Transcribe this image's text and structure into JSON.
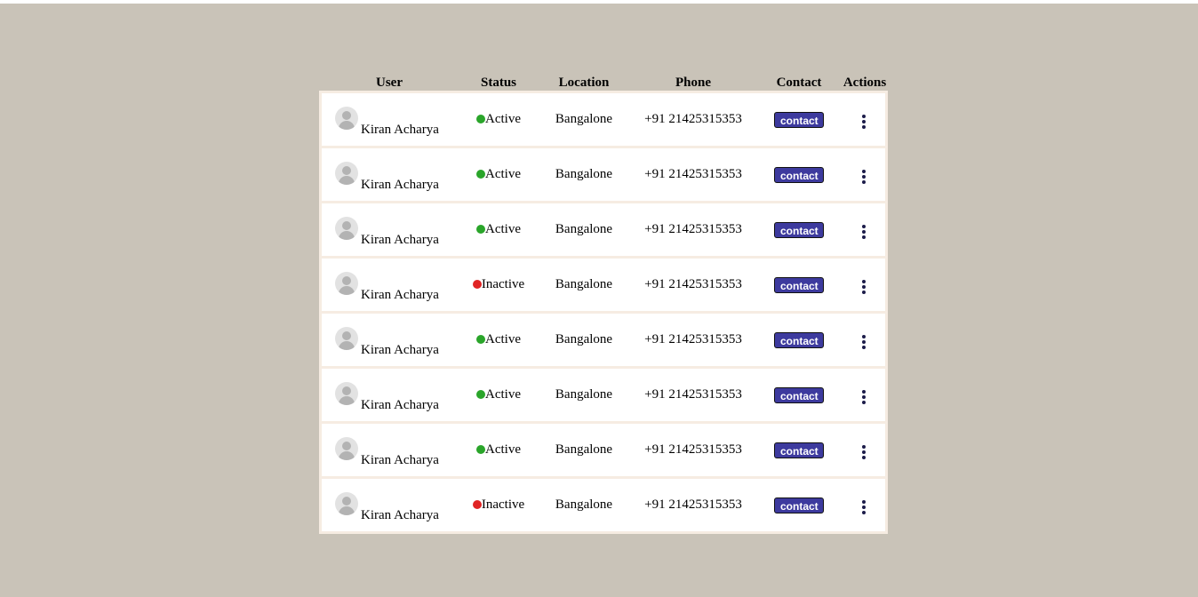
{
  "table": {
    "headers": {
      "user": "User",
      "status": "Status",
      "location": "Location",
      "phone": "Phone",
      "contact": "Contact",
      "actions": "Actions"
    },
    "rows": [
      {
        "name": "Kiran Acharya",
        "status": "Active",
        "status_color": "#2aa52a",
        "location": "Bangalone",
        "phone": "+91 21425315353",
        "contact_label": "contact"
      },
      {
        "name": "Kiran Acharya",
        "status": "Active",
        "status_color": "#2aa52a",
        "location": "Bangalone",
        "phone": "+91 21425315353",
        "contact_label": "contact"
      },
      {
        "name": "Kiran Acharya",
        "status": "Active",
        "status_color": "#2aa52a",
        "location": "Bangalone",
        "phone": "+91 21425315353",
        "contact_label": "contact"
      },
      {
        "name": "Kiran Acharya",
        "status": "Inactive",
        "status_color": "#e02424",
        "location": "Bangalone",
        "phone": "+91 21425315353",
        "contact_label": "contact"
      },
      {
        "name": "Kiran Acharya",
        "status": "Active",
        "status_color": "#2aa52a",
        "location": "Bangalone",
        "phone": "+91 21425315353",
        "contact_label": "contact"
      },
      {
        "name": "Kiran Acharya",
        "status": "Active",
        "status_color": "#2aa52a",
        "location": "Bangalone",
        "phone": "+91 21425315353",
        "contact_label": "contact"
      },
      {
        "name": "Kiran Acharya",
        "status": "Active",
        "status_color": "#2aa52a",
        "location": "Bangalone",
        "phone": "+91 21425315353",
        "contact_label": "contact"
      },
      {
        "name": "Kiran Acharya",
        "status": "Inactive",
        "status_color": "#e02424",
        "location": "Bangalone",
        "phone": "+91 21425315353",
        "contact_label": "contact"
      }
    ]
  },
  "icons": {
    "avatar": "user-avatar-icon",
    "actions": "more-vertical-icon"
  },
  "colors": {
    "background": "#c9c3b8",
    "button": "#3d3a9e",
    "active": "#2aa52a",
    "inactive": "#e02424"
  }
}
